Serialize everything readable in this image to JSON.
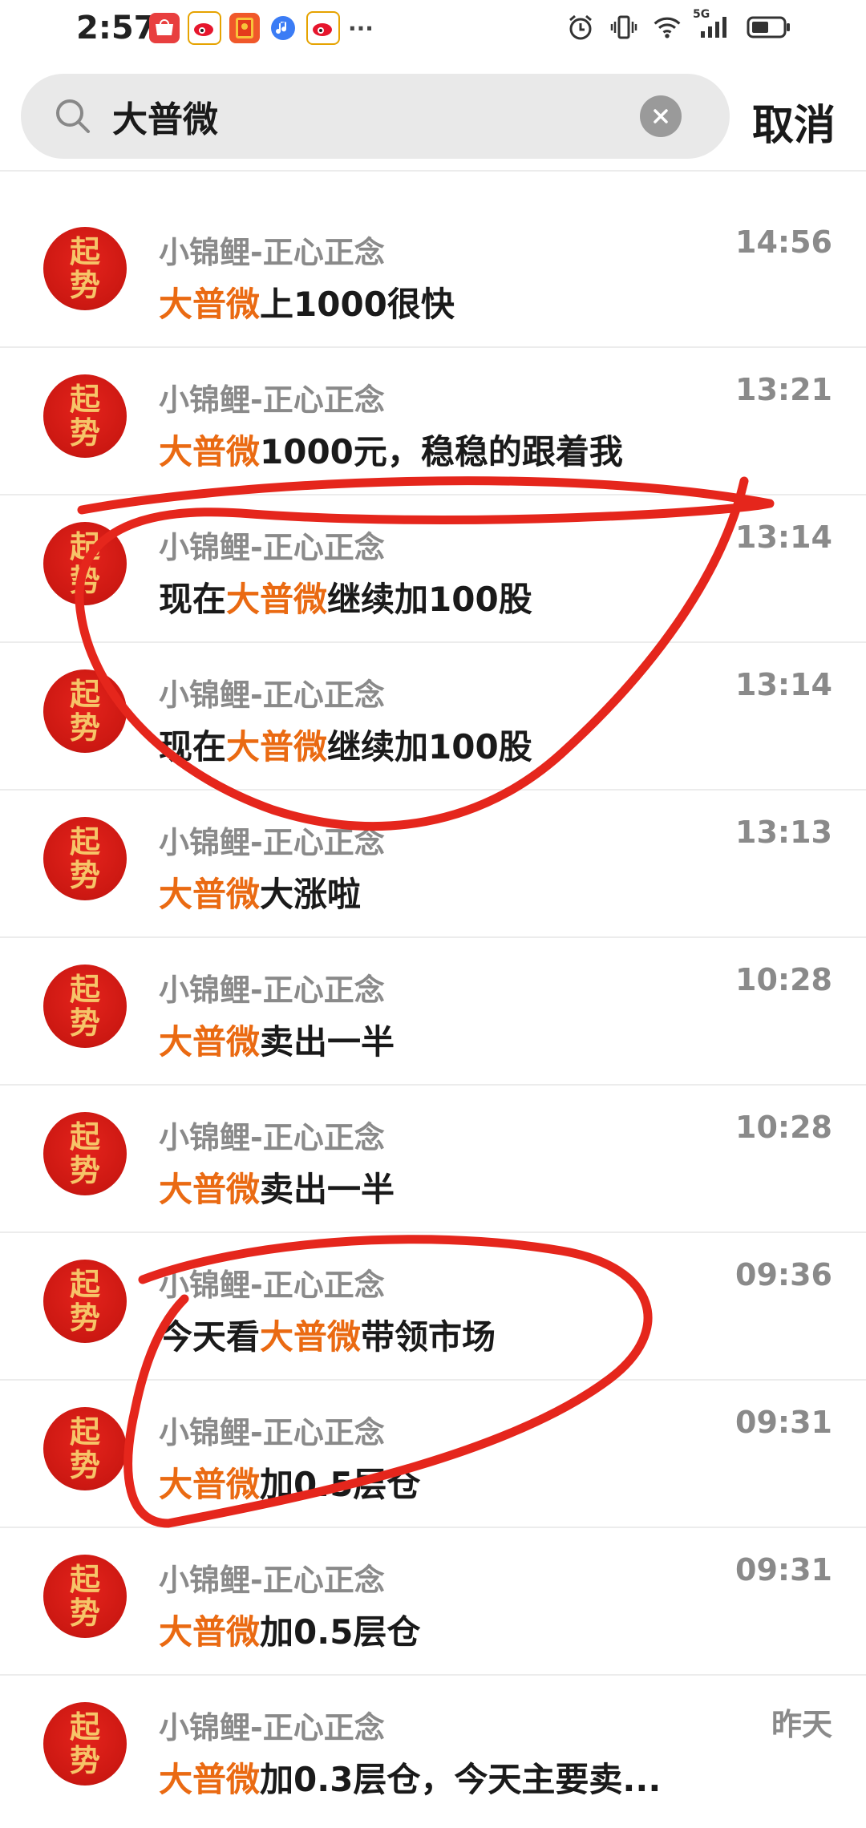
{
  "status_bar": {
    "time": "2:57",
    "notification_icons": [
      "huawei-store-icon",
      "weibo-icon",
      "red-envelope-icon",
      "music-icon",
      "weibo-alt-icon"
    ],
    "more": "···",
    "system_icons": [
      "alarm-icon",
      "vibrate-icon",
      "wifi-icon",
      "5g-signal-icon",
      "battery-icon"
    ],
    "network_label": "5G"
  },
  "search": {
    "query": "大普微",
    "cancel_label": "取消"
  },
  "avatar_text": {
    "line1": "起",
    "line2": "势"
  },
  "messages": [
    {
      "sender": "小锦鲤-正心正念",
      "time": "14:56",
      "before": "",
      "keyword": "大普微",
      "after": "上1000很快"
    },
    {
      "sender": "小锦鲤-正心正念",
      "time": "13:21",
      "before": "",
      "keyword": "大普微",
      "after": "1000元，稳稳的跟着我"
    },
    {
      "sender": "小锦鲤-正心正念",
      "time": "13:14",
      "before": "现在",
      "keyword": "大普微",
      "after": "继续加100股"
    },
    {
      "sender": "小锦鲤-正心正念",
      "time": "13:14",
      "before": "现在",
      "keyword": "大普微",
      "after": "继续加100股"
    },
    {
      "sender": "小锦鲤-正心正念",
      "time": "13:13",
      "before": "",
      "keyword": "大普微",
      "after": "大涨啦"
    },
    {
      "sender": "小锦鲤-正心正念",
      "time": "10:28",
      "before": "",
      "keyword": "大普微",
      "after": "卖出一半"
    },
    {
      "sender": "小锦鲤-正心正念",
      "time": "10:28",
      "before": "",
      "keyword": "大普微",
      "after": "卖出一半"
    },
    {
      "sender": "小锦鲤-正心正念",
      "time": "09:36",
      "before": "今天看",
      "keyword": "大普微",
      "after": "带领市场"
    },
    {
      "sender": "小锦鲤-正心正念",
      "time": "09:31",
      "before": "",
      "keyword": "大普微",
      "after": "加0.5层仓"
    },
    {
      "sender": "小锦鲤-正心正念",
      "time": "09:31",
      "before": "",
      "keyword": "大普微",
      "after": "加0.5层仓"
    },
    {
      "sender": "小锦鲤-正心正念",
      "time": "昨天",
      "before": "",
      "keyword": "大普微",
      "after": "加0.3层仓，今天主要卖..."
    }
  ],
  "colors": {
    "highlight": "#ea6a12",
    "annotation": "#e5261c",
    "avatar_bg": "#cc1812",
    "avatar_text": "#f6c468"
  }
}
